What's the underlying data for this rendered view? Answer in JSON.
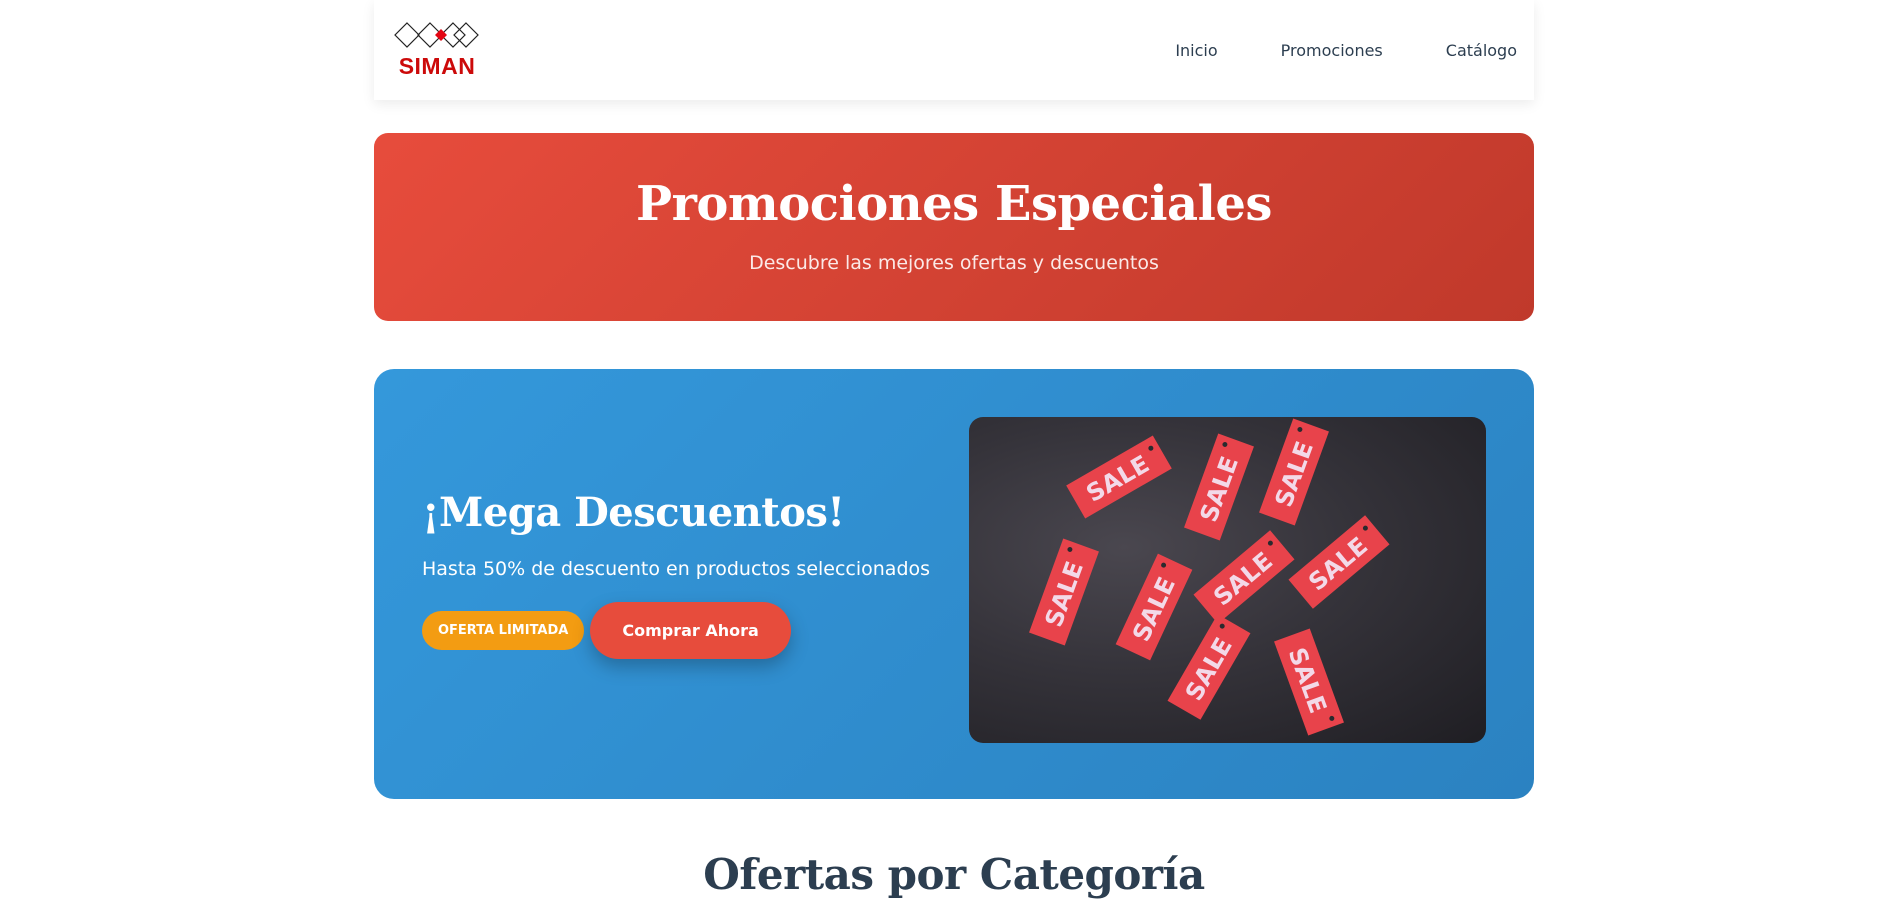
{
  "brand": {
    "name": "SIMAN",
    "accent": "#cc0a0a"
  },
  "nav": {
    "items": [
      {
        "label": "Inicio"
      },
      {
        "label": "Promociones"
      },
      {
        "label": "Catálogo"
      }
    ]
  },
  "hero": {
    "title": "Promociones Especiales",
    "subtitle": "Descubre las mejores ofertas y descuentos",
    "colors": [
      "#e74c3c",
      "#c0392b"
    ]
  },
  "promo": {
    "title": "¡Mega Descuentos!",
    "description": "Hasta 50% de descuento en productos seleccionados",
    "badge": "OFERTA LIMITADA",
    "cta_label": "Comprar Ahora",
    "image_tag_text": "SALE",
    "colors": {
      "card": "#3498db",
      "badge": "#f39c12",
      "cta": "#e74c3c",
      "tag": "#e8434b"
    }
  },
  "sections": {
    "category_title": "Ofertas por Categoría"
  }
}
